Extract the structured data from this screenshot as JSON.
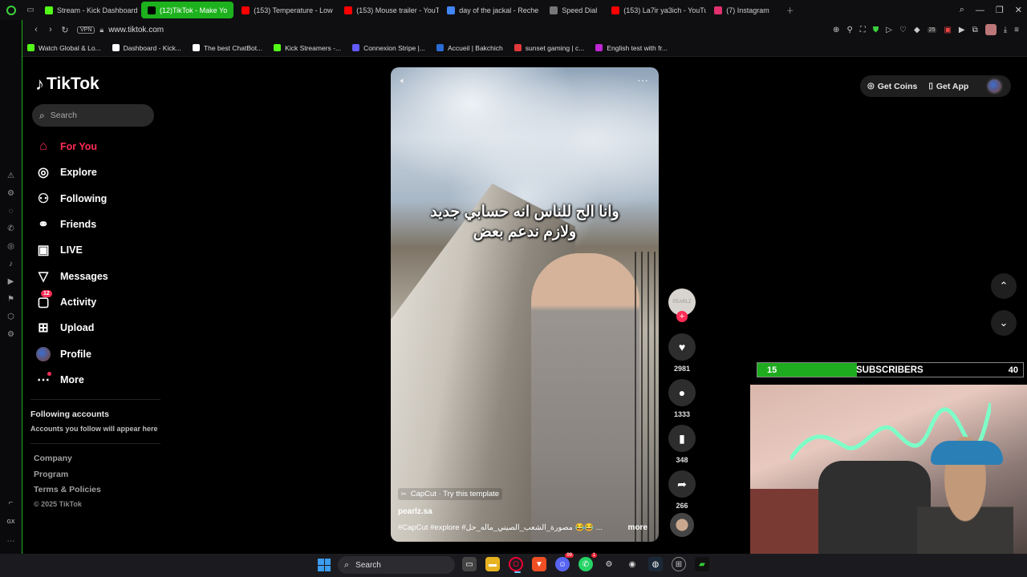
{
  "browser": {
    "tabs": [
      {
        "label": "Stream - Kick Dashboard",
        "color": "#53fc18",
        "active": false
      },
      {
        "label": "(12)TikTok - Make Yo",
        "color": "#000000",
        "active": true
      },
      {
        "label": "(153) Temperature - Low",
        "color": "#ff0000",
        "active": false
      },
      {
        "label": "(153) Mouse trailer - YouT",
        "color": "#ff0000",
        "active": false
      },
      {
        "label": "day of the jackal - Reche",
        "color": "#4285f4",
        "active": false
      },
      {
        "label": "Speed Dial",
        "color": "#777777",
        "active": false
      },
      {
        "label": "(153) La7ir ya3ich - YouTu",
        "color": "#ff0000",
        "active": false
      },
      {
        "label": "(7) Instagram",
        "color": "#e1306c",
        "active": false
      }
    ],
    "vpn_label": "VPN",
    "url": "www.tiktok.com",
    "bookmarks": [
      {
        "label": "Watch Global & Lo...",
        "color": "#53fc18"
      },
      {
        "label": "Dashboard - Kick...",
        "color": "#ffffff"
      },
      {
        "label": "The best ChatBot...",
        "color": "#ffffff"
      },
      {
        "label": "Kick Streamers -...",
        "color": "#53fc18"
      },
      {
        "label": "Connexion Stripe |...",
        "color": "#635bff"
      },
      {
        "label": "Accueil | Bakchich",
        "color": "#2a6bd6"
      },
      {
        "label": "sunset gaming | c...",
        "color": "#e23a3a"
      },
      {
        "label": "English test with fr...",
        "color": "#c026d3"
      }
    ],
    "ext_badge": "25"
  },
  "tiktok": {
    "logo": "TikTok",
    "search_placeholder": "Search",
    "nav": [
      {
        "label": "For You",
        "icon": "home-icon",
        "active": true
      },
      {
        "label": "Explore",
        "icon": "compass-icon",
        "active": false
      },
      {
        "label": "Following",
        "icon": "following-icon",
        "active": false
      },
      {
        "label": "Friends",
        "icon": "friends-icon",
        "active": false
      },
      {
        "label": "LIVE",
        "icon": "live-icon",
        "active": false
      },
      {
        "label": "Messages",
        "icon": "messages-icon",
        "active": false
      },
      {
        "label": "Activity",
        "icon": "activity-icon",
        "active": false,
        "badge": "12"
      },
      {
        "label": "Upload",
        "icon": "upload-icon",
        "active": false
      },
      {
        "label": "Profile",
        "icon": "avatar-icon",
        "active": false
      },
      {
        "label": "More",
        "icon": "more-icon",
        "active": false
      }
    ],
    "following_title": "Following accounts",
    "following_sub": "Accounts you follow will appear here",
    "footer_links": [
      "Company",
      "Program",
      "Terms & Policies"
    ],
    "copyright": "© 2025 TikTok",
    "get_coins": "Get Coins",
    "get_app": "Get App",
    "video": {
      "caption_line1": "وانا الح للناس انه حسابي جديد",
      "caption_line2": "ولازم ندعم بعض",
      "capcut": "CapCut · Try this template",
      "author": "pearlz.sa",
      "description": "#CapCut  #explore  #مصورة_الشعب_الصيني_ماله_حل 😂😂 ...",
      "more": "more",
      "creator_avatar_text": "PEARLZ"
    },
    "actions": {
      "likes": "2981",
      "comments": "1333",
      "saves": "348",
      "shares": "266"
    }
  },
  "stream_overlay": {
    "current": "15",
    "label": "SUBSCRIBERS",
    "goal": "40",
    "progress_fraction": 0.375,
    "bar_color": "#1fab1f"
  },
  "taskbar": {
    "search_label": "Search",
    "discord_badge": "99",
    "whatsapp_badge": "1"
  }
}
